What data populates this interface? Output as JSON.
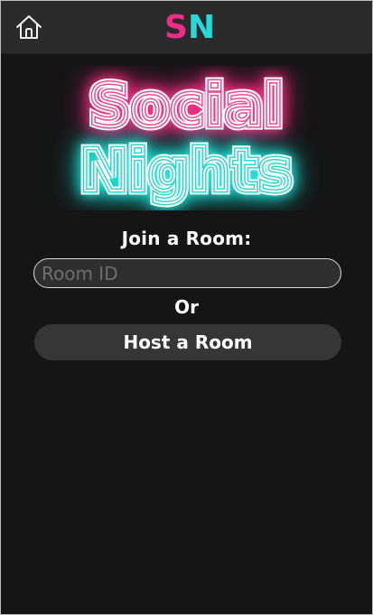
{
  "app": {
    "title": "Social Nights",
    "brand_mark": {
      "first": "S",
      "second": "N",
      "first_color": "#ee2d8b",
      "second_color": "#25d9d9"
    }
  },
  "header": {
    "home_icon": "home-icon"
  },
  "hero": {
    "line1": "Social",
    "line2": "Nights",
    "line1_glow": "#ff3d8f",
    "line2_glow": "#28f0e6"
  },
  "join": {
    "label": "Join a Room:",
    "placeholder": "Room ID",
    "value": ""
  },
  "divider": {
    "label": "Or"
  },
  "host": {
    "label": "Host a Room"
  }
}
